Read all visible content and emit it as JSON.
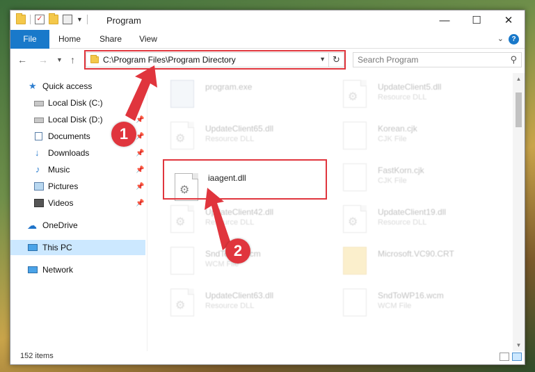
{
  "window": {
    "title": "Program",
    "controls": {
      "minimize": "—",
      "maximize": "☐",
      "close": "✕"
    }
  },
  "ribbon": {
    "tabs": [
      "File",
      "Home",
      "Share",
      "View"
    ]
  },
  "navigation": {
    "address": "C:\\Program Files\\Program Directory",
    "search_placeholder": "Search Program"
  },
  "sidebar": {
    "items": [
      {
        "label": "Quick access",
        "icon": "star-icon",
        "pinned": false
      },
      {
        "label": "Local Disk (C:)",
        "icon": "drive-icon",
        "pinned": false
      },
      {
        "label": "Local Disk (D:)",
        "icon": "drive-icon",
        "pinned": true
      },
      {
        "label": "Documents",
        "icon": "documents-icon",
        "pinned": true
      },
      {
        "label": "Downloads",
        "icon": "downloads-icon",
        "pinned": true
      },
      {
        "label": "Music",
        "icon": "music-icon",
        "pinned": true
      },
      {
        "label": "Pictures",
        "icon": "pictures-icon",
        "pinned": true
      },
      {
        "label": "Videos",
        "icon": "videos-icon",
        "pinned": true
      },
      {
        "label": "OneDrive",
        "icon": "onedrive-icon",
        "pinned": false
      },
      {
        "label": "This PC",
        "icon": "this-pc-icon",
        "pinned": false,
        "selected": true
      },
      {
        "label": "Network",
        "icon": "network-icon",
        "pinned": false
      }
    ]
  },
  "files": [
    {
      "name": "program.exe",
      "type": "",
      "icon": "exe-icon"
    },
    {
      "name": "UpdateClient5.dll",
      "type": "Resource DLL",
      "icon": "dll-icon"
    },
    {
      "name": "UpdateClient65.dll",
      "type": "Resource DLL",
      "icon": "dll-icon"
    },
    {
      "name": "Korean.cjk",
      "type": "CJK File",
      "icon": "document-icon"
    },
    {
      "name": "iaagent.dll",
      "type": "",
      "icon": "dll-icon",
      "highlighted": true
    },
    {
      "name": "FastKorn.cjk",
      "type": "CJK File",
      "icon": "document-icon"
    },
    {
      "name": "UpdateClient42.dll",
      "type": "Resource DLL",
      "icon": "dll-icon"
    },
    {
      "name": "UpdateClient19.dll",
      "type": "Resource DLL",
      "icon": "dll-icon"
    },
    {
      "name": "SndToWP.wcm",
      "type": "WCM File",
      "icon": "document-icon"
    },
    {
      "name": "Microsoft.VC90.CRT",
      "type": "",
      "icon": "folder-icon"
    },
    {
      "name": "UpdateClient63.dll",
      "type": "Resource DLL",
      "icon": "dll-icon"
    },
    {
      "name": "SndToWP16.wcm",
      "type": "WCM File",
      "icon": "document-icon"
    }
  ],
  "status": {
    "item_count": "152 items"
  },
  "annotations": {
    "step1": "1",
    "step2": "2",
    "color": "#e0353d"
  }
}
